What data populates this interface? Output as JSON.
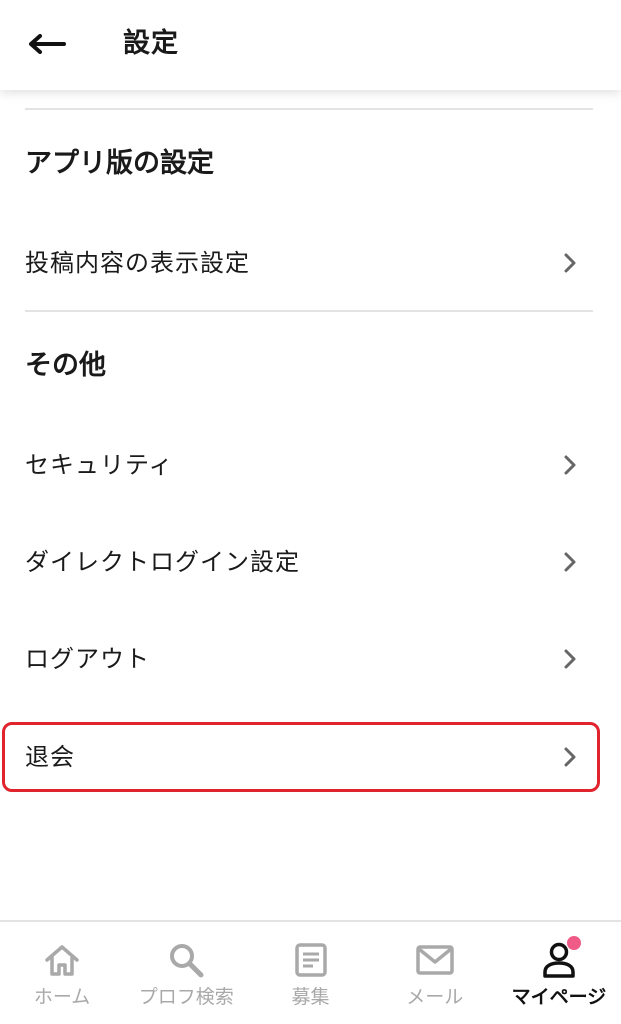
{
  "header": {
    "title": "設定",
    "back_icon": "arrow-left-icon"
  },
  "sections": {
    "app": {
      "title": "アプリ版の設定",
      "items": [
        {
          "label": "投稿内容の表示設定"
        }
      ]
    },
    "other": {
      "title": "その他",
      "items": [
        {
          "label": "セキュリティ"
        },
        {
          "label": "ダイレクトログイン設定"
        },
        {
          "label": "ログアウト"
        },
        {
          "label": "退会"
        }
      ]
    }
  },
  "bottom_nav": {
    "items": [
      {
        "label": "ホーム",
        "icon": "home-icon"
      },
      {
        "label": "プロフ検索",
        "icon": "search-icon"
      },
      {
        "label": "募集",
        "icon": "document-icon"
      },
      {
        "label": "メール",
        "icon": "mail-icon"
      },
      {
        "label": "マイページ",
        "icon": "user-icon",
        "active": true
      }
    ]
  },
  "colors": {
    "highlight": "#e0232c",
    "badge": "#f05a86",
    "inactive": "#a9a9a9",
    "active": "#111111"
  }
}
